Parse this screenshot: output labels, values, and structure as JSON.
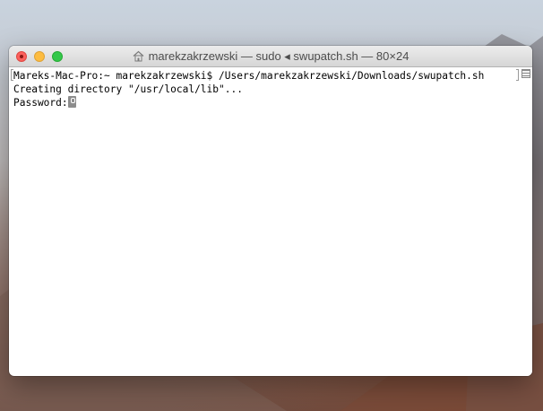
{
  "window": {
    "title": "marekzakrzewski — sudo ◂ swupatch.sh — 80×24"
  },
  "terminal": {
    "lines": [
      "Mareks-Mac-Pro:~ marekzakrzewski$ /Users/marekzakrzewski/Downloads/swupatch.sh",
      "Creating directory \"/usr/local/lib\"...",
      "Password:"
    ]
  },
  "icons": {
    "close": "close-button-icon",
    "minimize": "minimize-button-icon",
    "zoom": "zoom-button-icon",
    "home": "home-folder-icon",
    "cursor": "key-cursor-icon",
    "split": "split-view-icon"
  },
  "colors": {
    "close": "#fc605c",
    "minimize": "#fdbc40",
    "zoom": "#34c84a"
  }
}
